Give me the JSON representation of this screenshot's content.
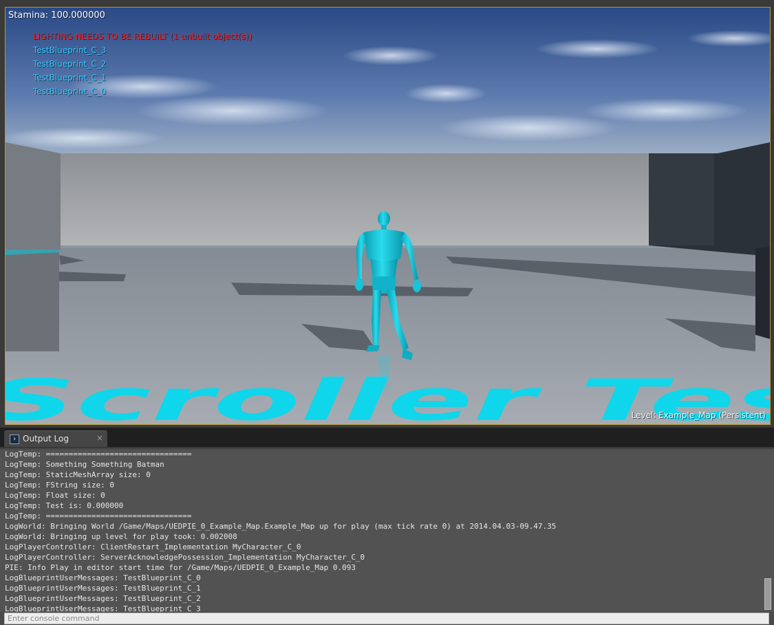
{
  "viewport": {
    "stamina_text": "Stamina: 100.000000",
    "lighting_warning": "LIGHTING NEEDS TO BE REBUILT (1 unbuilt object(s))",
    "debug_messages": [
      "TestBlueprint_C_3",
      "TestBlueprint_C_2",
      "TestBlueprint_C_1",
      "TestBlueprint_C_0"
    ],
    "floor_text": "Scroller Tes",
    "level_label": "Level:  Example_Map (Persistent)",
    "colors": {
      "frame_border": "#b59a3c",
      "warning": "#ff1a1a",
      "debug_text": "#35c8ff",
      "character": "#12c6dc"
    }
  },
  "tab": {
    "icon": "console-icon",
    "icon_glyph": "›",
    "label": "Output Log",
    "close": "×"
  },
  "log": {
    "lines": [
      "LogTemp: ================================",
      "LogTemp: Something Something Batman",
      "LogTemp:  StaticMeshArray size: 0",
      "LogTemp:  FString size: 0",
      "LogTemp:  Float size: 0",
      "LogTemp:  Test is: 0.000000",
      "LogTemp: ================================",
      "LogWorld: Bringing World /Game/Maps/UEDPIE_0_Example_Map.Example_Map up for play (max tick rate 0) at 2014.04.03-09.47.35",
      "LogWorld: Bringing up level for play took: 0.002008",
      "LogPlayerController: ClientRestart_Implementation MyCharacter_C_0",
      "LogPlayerController: ServerAcknowledgePossession_Implementation MyCharacter_C_0",
      "PIE: Info Play in editor start time for /Game/Maps/UEDPIE_0_Example_Map 0.093",
      "LogBlueprintUserMessages: TestBlueprint_C_0",
      "LogBlueprintUserMessages: TestBlueprint_C_1",
      "LogBlueprintUserMessages: TestBlueprint_C_2",
      "LogBlueprintUserMessages: TestBlueprint_C_3"
    ]
  },
  "console": {
    "placeholder": "Enter console command",
    "value": ""
  }
}
